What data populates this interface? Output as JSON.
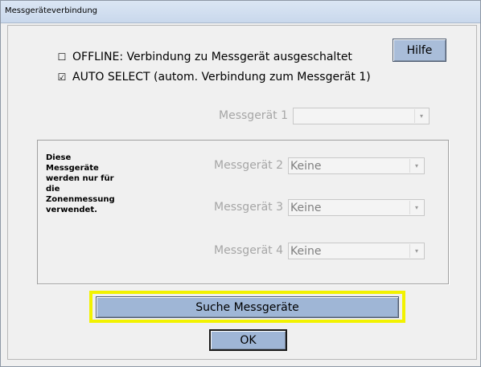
{
  "window": {
    "title": "Messgeräteverbindung"
  },
  "options": {
    "offline": {
      "checked": false,
      "check_glyph": "☐",
      "label": "OFFLINE: Verbindung zu Messgerät ausgeschaltet"
    },
    "auto_select": {
      "checked": true,
      "check_glyph": "☑",
      "label": "AUTO SELECT (autom. Verbindung zum Messgerät 1)"
    }
  },
  "buttons": {
    "help": "Hilfe",
    "search": "Suche Messgeräte",
    "ok": "OK"
  },
  "devices": {
    "device1": {
      "label": "Messgerät 1",
      "value": "",
      "enabled": false
    },
    "device2": {
      "label": "Messgerät 2",
      "value": "Keine",
      "enabled": false
    },
    "device3": {
      "label": "Messgerät 3",
      "value": "Keine",
      "enabled": false
    },
    "device4": {
      "label": "Messgerät 4",
      "value": "Keine",
      "enabled": false
    }
  },
  "zone_note": {
    "line1": "Diese",
    "line2": "Messgeräte",
    "line3": "werden nur für",
    "line4": "die",
    "line5": "Zonenmessung",
    "line6": "verwendet."
  },
  "icons": {
    "combo_arrow": "▾"
  },
  "colors": {
    "highlight": "#f2f200",
    "button_face": "#9fb6d6"
  }
}
